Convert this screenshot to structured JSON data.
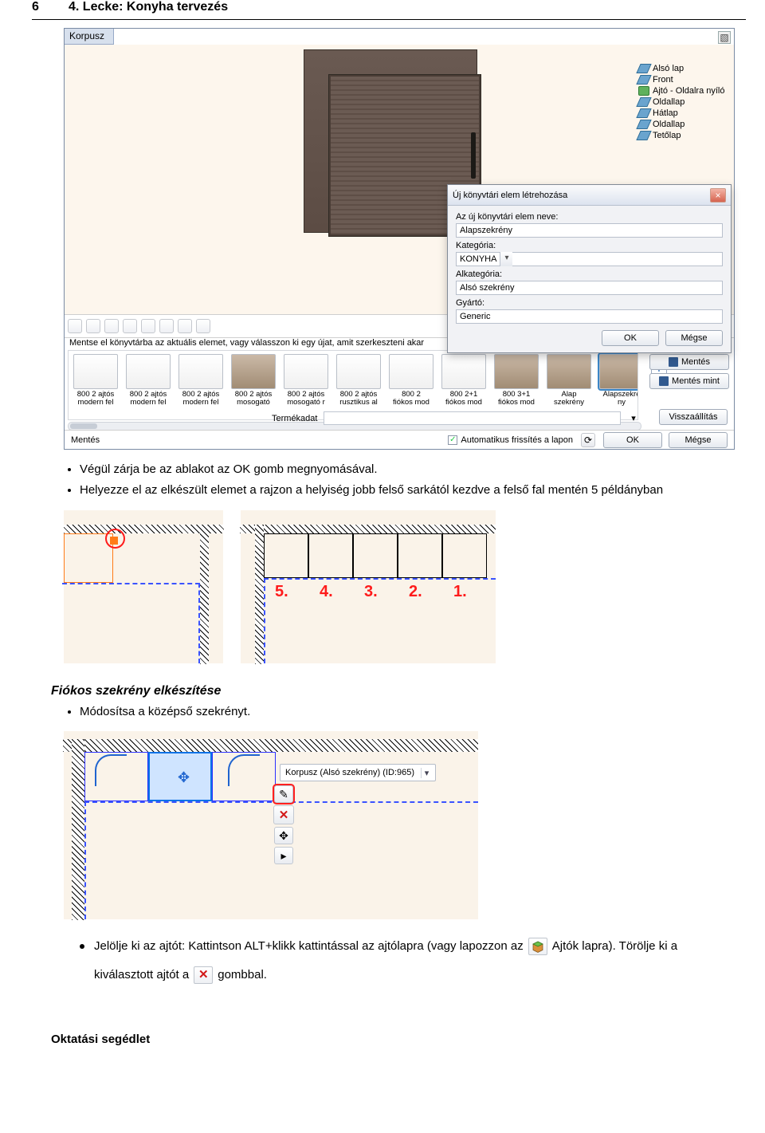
{
  "header": {
    "page_number": "6",
    "title": "4. Lecke: Konyha tervezés"
  },
  "shot1": {
    "tab": "Korpusz",
    "tree": [
      {
        "label": "Alsó lap",
        "icon": "panel"
      },
      {
        "label": "Front",
        "icon": "panel"
      },
      {
        "label": "Ajtó - Oldalra nyíló",
        "icon": "door"
      },
      {
        "label": "Oldallap",
        "icon": "panel"
      },
      {
        "label": "Hátlap",
        "icon": "panel"
      },
      {
        "label": "Oldallap",
        "icon": "panel"
      },
      {
        "label": "Tetőlap",
        "icon": "panel"
      }
    ],
    "hint": "Mentse el könyvtárba az aktuális elemet, vagy válasszon ki egy újat, amit szerkeszteni akar",
    "library": [
      {
        "l1": "800 2 ajtós",
        "l2": "modern fel"
      },
      {
        "l1": "800 2 ajtós",
        "l2": "modern fel"
      },
      {
        "l1": "800 2 ajtós",
        "l2": "modern fel"
      },
      {
        "l1": "800 2 ajtós",
        "l2": "mosogató"
      },
      {
        "l1": "800 2 ajtós",
        "l2": "mosogató r"
      },
      {
        "l1": "800 2 ajtós",
        "l2": "rusztikus al"
      },
      {
        "l1": "800 2",
        "l2": "fiókos mod"
      },
      {
        "l1": "800 2+1",
        "l2": "fiókos mod"
      },
      {
        "l1": "800 3+1",
        "l2": "fiókos mod"
      },
      {
        "l1": "Alap",
        "l2": "szekrény"
      },
      {
        "l1": "Alapszekré",
        "l2": "ny"
      }
    ],
    "save": "Mentés",
    "saveas": "Mentés mint",
    "product_label": "Termékadat",
    "reset": "Visszaállítás",
    "tab_label": "Mentés",
    "auto": "Automatikus frissítés a lapon",
    "ok": "OK",
    "cancel": "Mégse"
  },
  "dialog": {
    "title": "Új könyvtári elem létrehozása",
    "f1_label": "Az új könyvtári elem neve:",
    "f1_value": "Alapszekrény",
    "f2_label": "Kategória:",
    "f2_value": "KONYHA",
    "f3_label": "Alkategória:",
    "f3_value": "Alsó szekrény",
    "f4_label": "Gyártó:",
    "f4_value": "Generic",
    "ok": "OK",
    "cancel": "Mégse"
  },
  "bullet1": "Végül zárja be az ablakot az OK gomb megnyomásával.",
  "bullet2": "Helyezze el az elkészült elemet a rajzon a helyiség jobb felső sarkától kezdve a felső fal mentén 5 példányban",
  "nums": [
    "5.",
    "4.",
    "3.",
    "2.",
    "1."
  ],
  "subheading": "Fiókos szekrény elkészítése",
  "bullet3": "Módosítsa a középső szekrényt.",
  "popup_text": "Korpusz (Alsó szekrény) (ID:965)",
  "note_a": "Jelölje ki az ajtót: Kattintson ALT+klikk kattintással az ajtólapra (vagy lapozzon az",
  "note_b": "Ajtók lapra). Törölje ki a",
  "note_c": "kiválasztott ajtót a",
  "note_d": "gombbal.",
  "footer": "Oktatási segédlet"
}
